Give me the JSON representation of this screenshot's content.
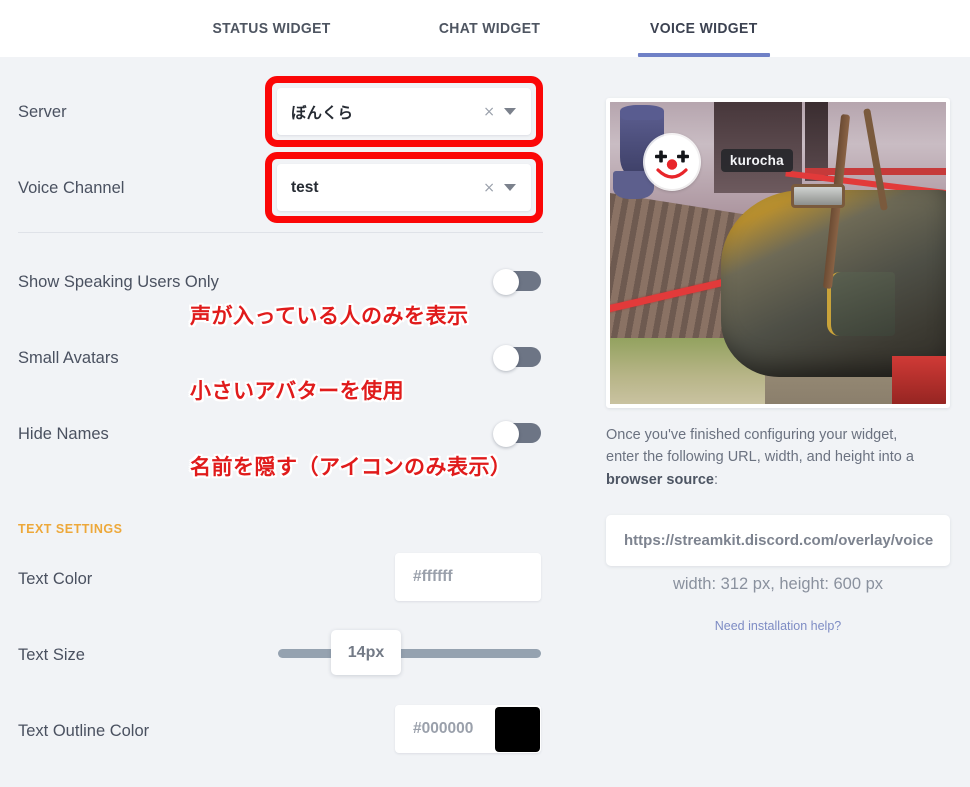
{
  "tabs": [
    {
      "label": "STATUS WIDGET",
      "active": false
    },
    {
      "label": "CHAT WIDGET",
      "active": false
    },
    {
      "label": "VOICE WIDGET",
      "active": true
    }
  ],
  "form": {
    "server": {
      "label": "Server",
      "value": "ぼんくら",
      "clear_icon": "×",
      "annotated": true
    },
    "voice_channel": {
      "label": "Voice Channel",
      "value": "test",
      "clear_icon": "×",
      "annotated": true
    },
    "toggles": [
      {
        "label": "Show Speaking Users Only",
        "state": "off",
        "annotation": "声が入っている人のみを表示"
      },
      {
        "label": "Small Avatars",
        "state": "off",
        "annotation": "小さいアバターを使用"
      },
      {
        "label": "Hide Names",
        "state": "off",
        "annotation": "名前を隠す（アイコンのみ表示）"
      }
    ],
    "text_settings": {
      "heading": "TEXT SETTINGS",
      "text_color": {
        "label": "Text Color",
        "value": "#ffffff",
        "swatch": "#ffffff"
      },
      "text_size": {
        "label": "Text Size",
        "value": "14px"
      },
      "text_outline_color": {
        "label": "Text Outline Color",
        "value": "#000000",
        "swatch": "#000000"
      }
    }
  },
  "preview": {
    "username": "kurocha",
    "avatar_icon": "clown-face-icon"
  },
  "instructions": {
    "line_a": "Once you've finished configuring your widget, enter the following URL, width, and height into a ",
    "bold": "browser source",
    "line_b": ":"
  },
  "url": {
    "value": "https://streamkit.discord.com/overlay/voice"
  },
  "dimensions": {
    "text": "width: 312 px, height: 600 px"
  },
  "help": {
    "label": "Need installation help?"
  },
  "colors": {
    "page_bg": "#f1f3f6",
    "tab_active_underline": "#6f80c6",
    "section_heading": "#eda83a",
    "annotation_red": "#e01b1b",
    "annotation_box_red": "#fb0707",
    "toggle_track": "#6d7585",
    "slider_track": "#95a2b0",
    "link": "#7e8cc4"
  }
}
